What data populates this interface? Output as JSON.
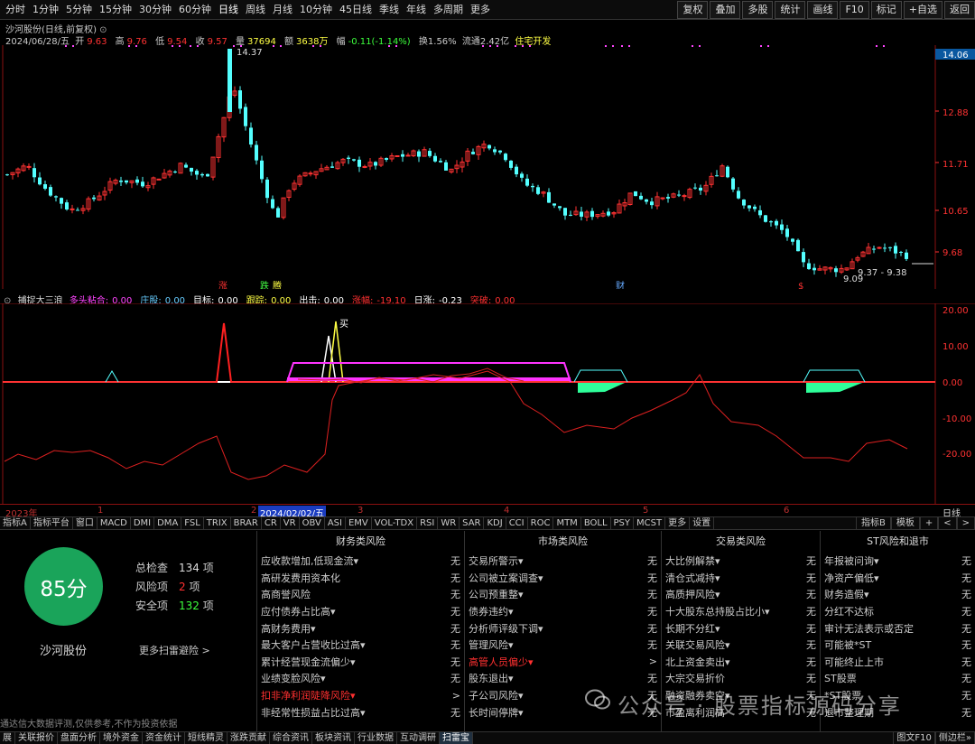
{
  "toolbar": {
    "periods": [
      "分时",
      "1分钟",
      "5分钟",
      "15分钟",
      "30分钟",
      "60分钟",
      "日线",
      "周线",
      "月线",
      "10分钟",
      "45日线",
      "季线",
      "年线",
      "多周期",
      "更多"
    ],
    "active_period": "日线",
    "right_buttons": [
      "复权",
      "叠加",
      "多股",
      "统计",
      "画线",
      "F10",
      "标记",
      "+自选",
      "返回"
    ]
  },
  "stock": {
    "title": "沙河股份(日线,前复权)",
    "date": "2024/06/28/五",
    "open_label": "开",
    "open": "9.63",
    "high_label": "高",
    "high": "9.76",
    "low_label": "低",
    "low": "9.54",
    "close_label": "收",
    "close": "9.57",
    "volume_label": "量",
    "volume": "37694",
    "amount_label": "额",
    "amount": "3638万",
    "change_label": "幅",
    "change": "-0.11(-1.14%)",
    "turnover": "换1.56%",
    "float_cap": "流通2.42亿",
    "sector": "住宅开发"
  },
  "price_chart": {
    "axis_labels": [
      "14.06",
      "12.88",
      "11.71",
      "10.65",
      "9.68"
    ],
    "max_label": "14.37",
    "min_label": "9.09",
    "range_label": "9.37 - 9.38",
    "event_labels": [
      "涨",
      "跌",
      "腾",
      "财",
      "$"
    ],
    "colors": {
      "up": "#ff3232",
      "down": "#54ffff",
      "axis": "#ff3232"
    }
  },
  "indicator": {
    "name": "捕捉大三浪",
    "fields": [
      {
        "label": "多头粘合:",
        "value": "0.00",
        "color": "#ff44ff"
      },
      {
        "label": "庄股:",
        "value": "0.00",
        "color": "#66ccff"
      },
      {
        "label": "目标:",
        "value": "0.00",
        "color": "#ffffff"
      },
      {
        "label": "跟踪:",
        "value": "0.00",
        "color": "#ffff44"
      },
      {
        "label": "出击:",
        "value": "0.00",
        "color": "#ffffff"
      },
      {
        "label": "涨幅:",
        "value": "-19.10",
        "color": "#ff3030"
      },
      {
        "label": "日涨:",
        "value": "-0.23",
        "color": "#ffffff"
      },
      {
        "label": "突破:",
        "value": "0.00",
        "color": "#ff3030"
      }
    ],
    "axis_labels": [
      "20.00",
      "10.00",
      "0.00",
      "-10.00",
      "-20.00"
    ],
    "buy_label": "买"
  },
  "timeline": {
    "labels": [
      "2023年",
      "1",
      "2",
      "2024/02/02/五",
      "3",
      "4",
      "5",
      "6"
    ],
    "period_label": "日线"
  },
  "indicator_tabs": [
    "指标A",
    "指标平台",
    "窗口",
    "MACD",
    "DMI",
    "DMA",
    "FSL",
    "TRIX",
    "BRAR",
    "CR",
    "VR",
    "OBV",
    "ASI",
    "EMV",
    "VOL-TDX",
    "RSI",
    "WR",
    "SAR",
    "KDJ",
    "CCI",
    "ROC",
    "MTM",
    "BOLL",
    "PSY",
    "MCST",
    "更多",
    "设置"
  ],
  "indicator_tabs_right": [
    "指标B",
    "模板",
    "+",
    "<",
    ">"
  ],
  "scan": {
    "score": "85分",
    "stock_name": "沙河股份",
    "check_label": "总检查",
    "check_count": "134",
    "check_unit": "项",
    "risk_label": "风险项",
    "risk_count": "2",
    "risk_unit": "项",
    "safe_label": "安全项",
    "safe_count": "132",
    "safe_unit": "项",
    "more_link": "更多扫雷避险 >",
    "note": "通达信大数据评测,仅供参考,不作为投资依据",
    "columns": [
      {
        "title": "财务类风险",
        "items": [
          {
            "label": "应收款增加,低现金流▾",
            "value": "无",
            "risk": false
          },
          {
            "label": "高研发费用资本化",
            "value": "无",
            "risk": false
          },
          {
            "label": "高商誉风险",
            "value": "无",
            "risk": false
          },
          {
            "label": "应付债券占比高▾",
            "value": "无",
            "risk": false
          },
          {
            "label": "高财务费用▾",
            "value": "无",
            "risk": false
          },
          {
            "label": "最大客户占营收比过高▾",
            "value": "无",
            "risk": false
          },
          {
            "label": "累计经营现金流偏少▾",
            "value": "无",
            "risk": false
          },
          {
            "label": "业绩变脸风险▾",
            "value": "无",
            "risk": false
          },
          {
            "label": "扣非净利润陡降风险▾",
            "value": ">",
            "risk": true
          },
          {
            "label": "非经常性损益占比过高▾",
            "value": "无",
            "risk": false
          }
        ]
      },
      {
        "title": "市场类风险",
        "items": [
          {
            "label": "交易所警示▾",
            "value": "无",
            "risk": false
          },
          {
            "label": "公司被立案调查▾",
            "value": "无",
            "risk": false
          },
          {
            "label": "公司预重整▾",
            "value": "无",
            "risk": false
          },
          {
            "label": "债券违约▾",
            "value": "无",
            "risk": false
          },
          {
            "label": "分析师评级下调▾",
            "value": "无",
            "risk": false
          },
          {
            "label": "管理风险▾",
            "value": "无",
            "risk": false
          },
          {
            "label": "高管人员偏少▾",
            "value": ">",
            "risk": true
          },
          {
            "label": "股东退出▾",
            "value": "无",
            "risk": false
          },
          {
            "label": "子公司风险▾",
            "value": "无",
            "risk": false
          },
          {
            "label": "长时间停牌▾",
            "value": "无",
            "risk": false
          }
        ]
      },
      {
        "title": "交易类风险",
        "items": [
          {
            "label": "大比例解禁▾",
            "value": "无",
            "risk": false
          },
          {
            "label": "清仓式减持▾",
            "value": "无",
            "risk": false
          },
          {
            "label": "高质押风险▾",
            "value": "无",
            "risk": false
          },
          {
            "label": "十大股东总持股占比小▾",
            "value": "无",
            "risk": false
          },
          {
            "label": "长期不分红▾",
            "value": "无",
            "risk": false
          },
          {
            "label": "关联交易风险▾",
            "value": "无",
            "risk": false
          },
          {
            "label": "北上资金卖出▾",
            "value": "无",
            "risk": false
          },
          {
            "label": "大宗交易折价",
            "value": "无",
            "risk": false
          },
          {
            "label": "融资融券卖空▾",
            "value": "无",
            "risk": false
          },
          {
            "label": "市盈离利润高",
            "value": "无",
            "risk": false
          }
        ]
      },
      {
        "title": "ST风险和退市",
        "items": [
          {
            "label": "年报被问询▾",
            "value": "无",
            "risk": false
          },
          {
            "label": "净资产偏低▾",
            "value": "无",
            "risk": false
          },
          {
            "label": "财务造假▾",
            "value": "无",
            "risk": false
          },
          {
            "label": "分红不达标",
            "value": "无",
            "risk": false
          },
          {
            "label": "审计无法表示或否定",
            "value": "无",
            "risk": false
          },
          {
            "label": "可能被*ST",
            "value": "无",
            "risk": false
          },
          {
            "label": "可能终止上市",
            "value": "无",
            "risk": false
          },
          {
            "label": "ST股票",
            "value": "无",
            "risk": false
          },
          {
            "label": "*ST股票",
            "value": "无",
            "risk": false
          },
          {
            "label": "退市整理期",
            "value": "无",
            "risk": false
          }
        ]
      }
    ]
  },
  "watermark": "公众号 · 股票指标源码分享",
  "bottom_tabs": [
    "展",
    "关联报价",
    "盘面分析",
    "境外资金",
    "资金统计",
    "短线精灵",
    "涨跌贡献",
    "综合资讯",
    "板块资讯",
    "行业数据",
    "互动调研",
    "扫雷宝"
  ],
  "bottom_right": [
    "图文F10",
    "侧边栏»"
  ]
}
